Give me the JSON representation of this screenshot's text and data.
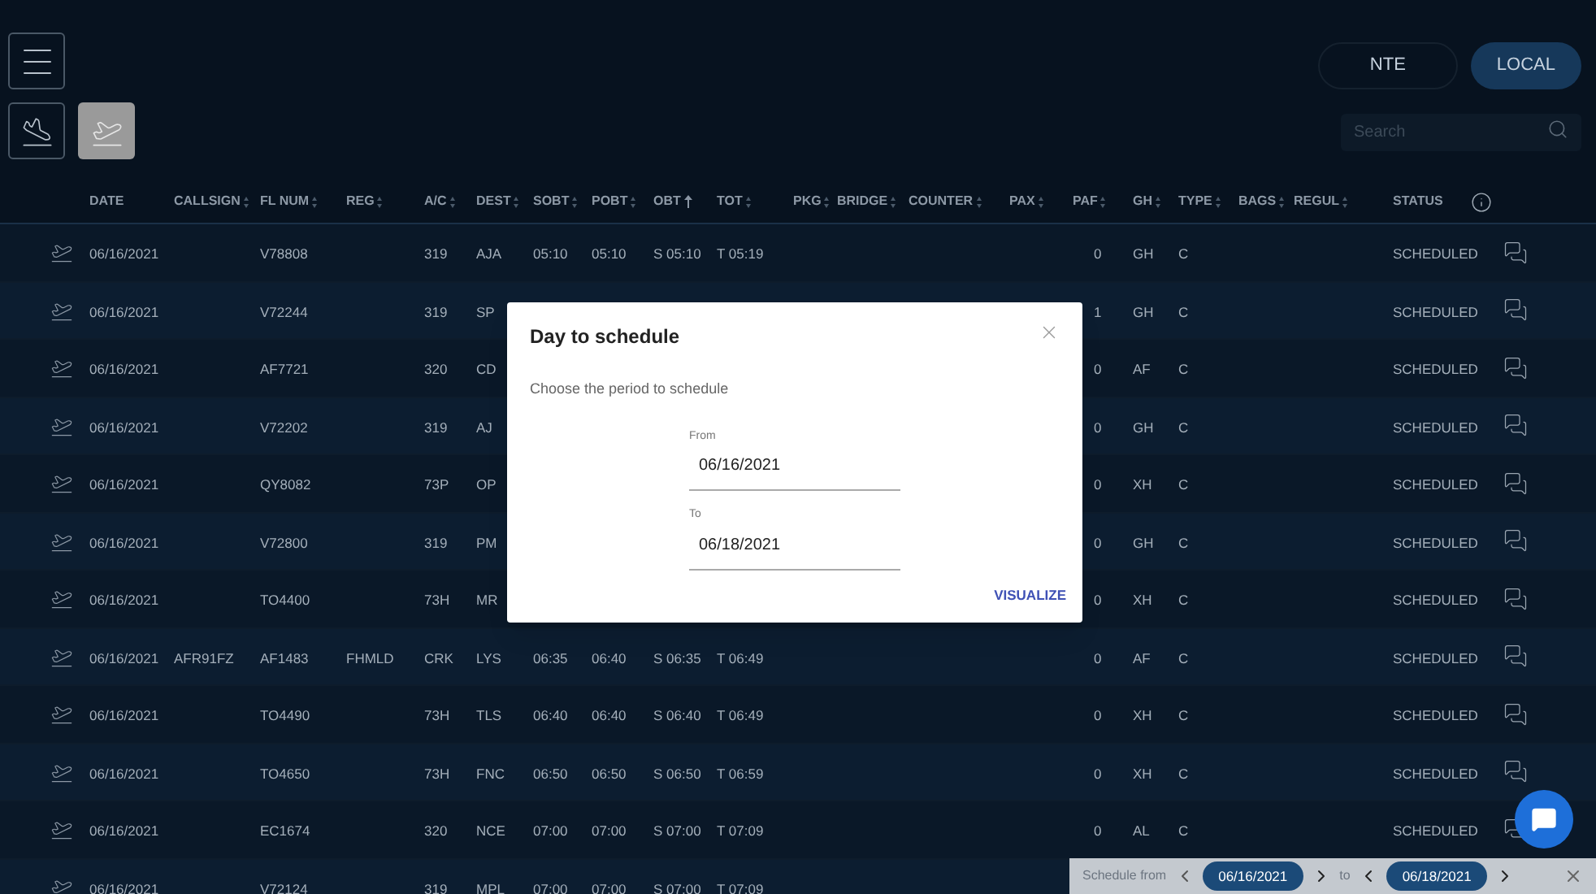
{
  "view_buttons": [
    {
      "kind": "arrivals",
      "selected": false
    },
    {
      "kind": "departures",
      "selected": true
    }
  ],
  "location_buttons": [
    {
      "label": "NTE",
      "selected": false
    },
    {
      "label": "LOCAL",
      "selected": true
    }
  ],
  "search": {
    "placeholder": "Search"
  },
  "table": {
    "columns": [
      {
        "label": "DATE",
        "kind": "plain"
      },
      {
        "label": "CALLSIGN",
        "kind": "sortable"
      },
      {
        "label": "FL NUM",
        "kind": "sortable"
      },
      {
        "label": "REG",
        "kind": "sortable"
      },
      {
        "label": "A/C",
        "kind": "sortable"
      },
      {
        "label": "DEST",
        "kind": "sortable"
      },
      {
        "label": "SOBT",
        "kind": "sortable"
      },
      {
        "label": "POBT",
        "kind": "sortable"
      },
      {
        "label": "OBT",
        "kind": "ascending"
      },
      {
        "label": "TOT",
        "kind": "sortable"
      },
      {
        "label": "PKG",
        "kind": "sortable"
      },
      {
        "label": "BRIDGE",
        "kind": "sortable"
      },
      {
        "label": "COUNTER",
        "kind": "sortable"
      },
      {
        "label": "PAX",
        "kind": "sortable"
      },
      {
        "label": "PAF",
        "kind": "sortable"
      },
      {
        "label": "GH",
        "kind": "sortable"
      },
      {
        "label": "TYPE",
        "kind": "sortable"
      },
      {
        "label": "BAGS",
        "kind": "sortable"
      },
      {
        "label": "REGUL",
        "kind": "sortable"
      },
      {
        "label": "STATUS",
        "kind": "info"
      }
    ],
    "rows": [
      {
        "cells": [
          "06/16/2021",
          null,
          "V78808",
          null,
          "319",
          "AJA",
          "05:10",
          "05:10",
          "S 05:10",
          "T 05:19",
          null,
          null,
          null,
          null,
          "0",
          "GH",
          "C",
          null,
          null,
          "SCHEDULED"
        ]
      },
      {
        "cells": [
          "06/16/2021",
          null,
          "V72244",
          null,
          "319",
          "SP",
          null,
          null,
          null,
          null,
          null,
          null,
          null,
          null,
          "1",
          "GH",
          "C",
          null,
          null,
          "SCHEDULED"
        ]
      },
      {
        "cells": [
          "06/16/2021",
          null,
          "AF7721",
          null,
          "320",
          "CD",
          null,
          null,
          null,
          null,
          null,
          null,
          null,
          null,
          "0",
          "AF",
          "C",
          null,
          null,
          "SCHEDULED"
        ]
      },
      {
        "cells": [
          "06/16/2021",
          null,
          "V72202",
          null,
          "319",
          "AJ",
          null,
          null,
          null,
          null,
          null,
          null,
          null,
          null,
          "0",
          "GH",
          "C",
          null,
          null,
          "SCHEDULED"
        ]
      },
      {
        "cells": [
          "06/16/2021",
          null,
          "QY8082",
          null,
          "73P",
          "OP",
          null,
          null,
          null,
          null,
          null,
          null,
          null,
          null,
          "0",
          "XH",
          "C",
          null,
          null,
          "SCHEDULED"
        ]
      },
      {
        "cells": [
          "06/16/2021",
          null,
          "V72800",
          null,
          "319",
          "PM",
          null,
          null,
          null,
          null,
          null,
          null,
          null,
          null,
          "0",
          "GH",
          "C",
          null,
          null,
          "SCHEDULED"
        ]
      },
      {
        "cells": [
          "06/16/2021",
          null,
          "TO4400",
          null,
          "73H",
          "MR",
          null,
          null,
          null,
          null,
          null,
          null,
          null,
          null,
          "0",
          "XH",
          "C",
          null,
          null,
          "SCHEDULED"
        ]
      },
      {
        "cells": [
          "06/16/2021",
          "AFR91FZ",
          "AF1483",
          "FHMLD",
          "CRK",
          "LYS",
          "06:35",
          "06:40",
          "S 06:35",
          "T 06:49",
          null,
          null,
          null,
          null,
          "0",
          "AF",
          "C",
          null,
          null,
          "SCHEDULED"
        ]
      },
      {
        "cells": [
          "06/16/2021",
          null,
          "TO4490",
          null,
          "73H",
          "TLS",
          "06:40",
          "06:40",
          "S 06:40",
          "T 06:49",
          null,
          null,
          null,
          null,
          "0",
          "XH",
          "C",
          null,
          null,
          "SCHEDULED"
        ]
      },
      {
        "cells": [
          "06/16/2021",
          null,
          "TO4650",
          null,
          "73H",
          "FNC",
          "06:50",
          "06:50",
          "S 06:50",
          "T 06:59",
          null,
          null,
          null,
          null,
          "0",
          "XH",
          "C",
          null,
          null,
          "SCHEDULED"
        ]
      },
      {
        "cells": [
          "06/16/2021",
          null,
          "EC1674",
          null,
          "320",
          "NCE",
          "07:00",
          "07:00",
          "S 07:00",
          "T 07:09",
          null,
          null,
          null,
          null,
          "0",
          "AL",
          "C",
          null,
          null,
          "SCHEDULED"
        ]
      },
      {
        "cells": [
          "06/16/2021",
          null,
          "V72124",
          null,
          "319",
          "MPL",
          "07:00",
          "07:00",
          "S 07:00",
          "T 07:09",
          null,
          null,
          null,
          null,
          null,
          null,
          null,
          null,
          null,
          null
        ]
      }
    ]
  },
  "dialog": {
    "title": "Day to schedule",
    "subtitle": "Choose the period to schedule",
    "fields": [
      {
        "label": "From",
        "value": "06/16/2021"
      },
      {
        "label": "To",
        "value": "06/18/2021"
      }
    ],
    "action": "VISUALIZE"
  },
  "schedule_bar": {
    "label": "Schedule from",
    "from": "06/16/2021",
    "separator": "to",
    "to": "06/18/2021"
  }
}
